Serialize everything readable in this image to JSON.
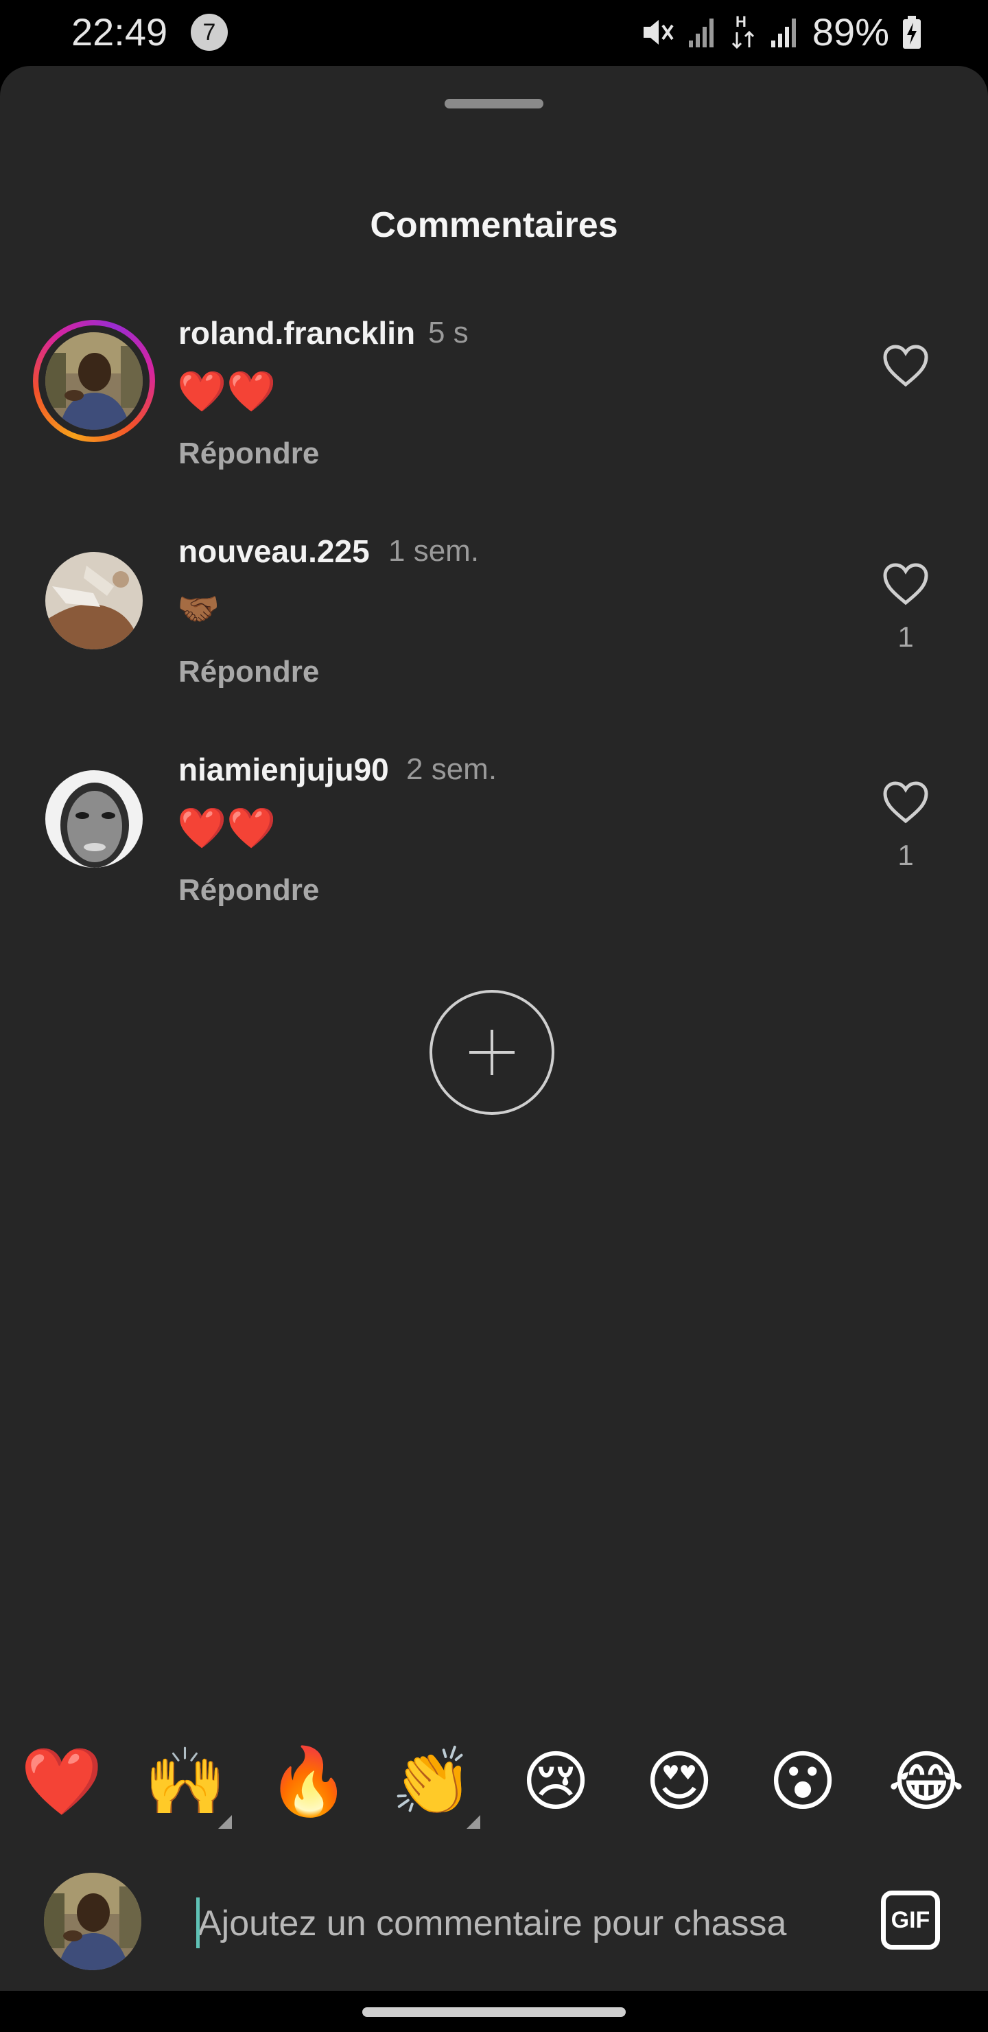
{
  "status_bar": {
    "time": "22:49",
    "notification_count": "7",
    "battery": "89%",
    "icons": [
      "mute-icon",
      "signal-icon",
      "network-h-icon",
      "signal-icon",
      "battery-charging-icon"
    ]
  },
  "sheet": {
    "title": "Commentaires"
  },
  "comments": [
    {
      "username": "roland.francklin",
      "time": "5 s",
      "text": "❤️❤️",
      "reply_label": "Répondre",
      "likes": "",
      "has_story_ring": true
    },
    {
      "username": "nouveau.225",
      "time": "1 sem.",
      "text": "🤝🏾",
      "reply_label": "Répondre",
      "likes": "1",
      "has_story_ring": false
    },
    {
      "username": "niamienjuju90",
      "time": "2 sem.",
      "text": "❤️❤️",
      "reply_label": "Répondre",
      "likes": "1",
      "has_story_ring": false
    }
  ],
  "load_more_icon": "plus-icon",
  "emoji_bar": [
    "❤️",
    "🙌",
    "🔥",
    "👏",
    "😢",
    "😍",
    "😮",
    "😂"
  ],
  "comment_input": {
    "placeholder": "Ajoutez un commentaire pour chassa",
    "gif_label": "GIF"
  },
  "colors": {
    "background": "#262626",
    "status_bar": "#000000",
    "muted_text": "#a8a8a8",
    "caret": "#5fc1b5"
  }
}
